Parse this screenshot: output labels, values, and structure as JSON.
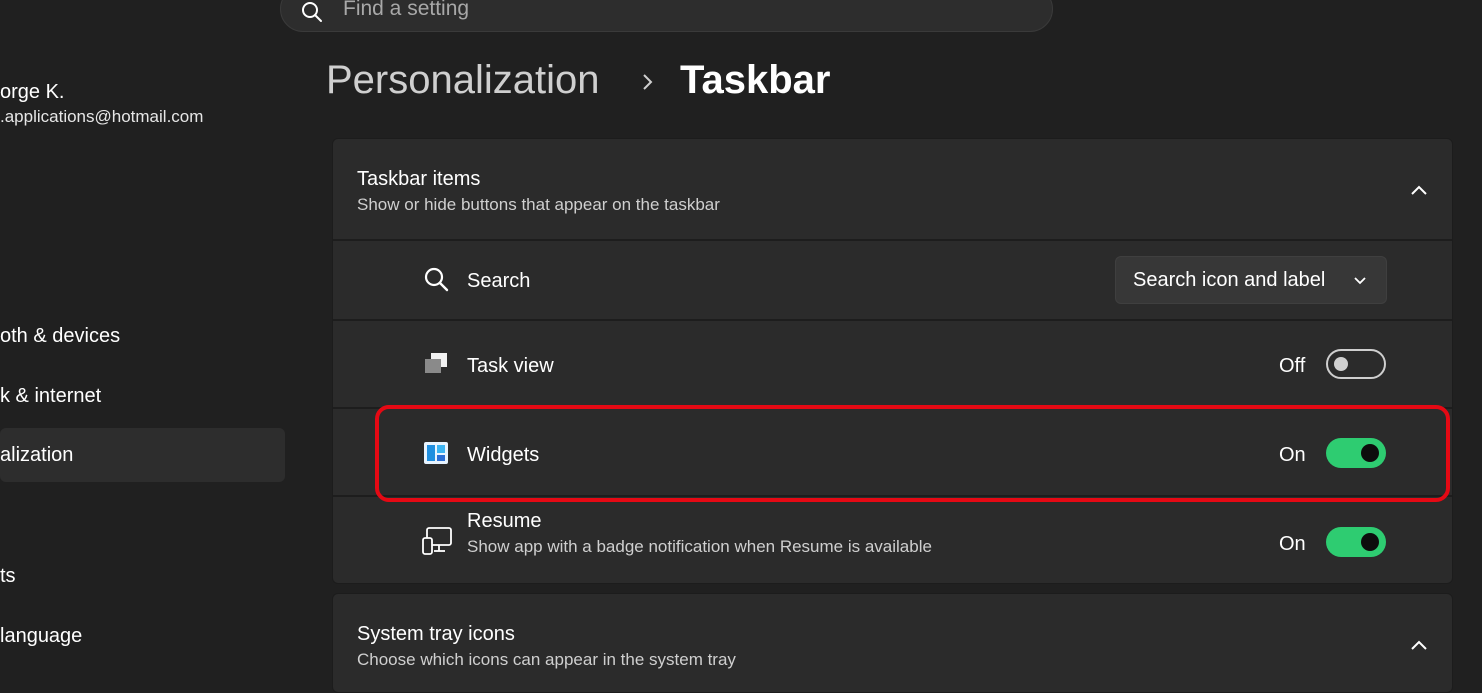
{
  "search": {
    "placeholder": "Find a setting"
  },
  "user": {
    "name": "orge K.",
    "email": ".applications@hotmail.com"
  },
  "sidebar": {
    "items": [
      {
        "label": "oth & devices"
      },
      {
        "label": "k & internet"
      },
      {
        "label": "alization",
        "selected": true
      },
      {
        "label": "ts"
      },
      {
        "label": " language"
      }
    ]
  },
  "breadcrumb": {
    "parent": "Personalization",
    "separator": "›",
    "current": "Taskbar"
  },
  "taskbar_items": {
    "title": "Taskbar items",
    "subtitle": "Show or hide buttons that appear on the taskbar",
    "rows": [
      {
        "label": "Search",
        "icon": "search-icon",
        "control": "dropdown",
        "value": "Search icon and label"
      },
      {
        "label": "Task view",
        "icon": "task-view-icon",
        "control": "toggle",
        "state": "Off"
      },
      {
        "label": "Widgets",
        "icon": "widgets-icon",
        "control": "toggle",
        "state": "On",
        "highlighted": true
      },
      {
        "label": "Resume",
        "subtitle": "Show app with a badge notification when Resume is available",
        "icon": "resume-icon",
        "control": "toggle",
        "state": "On"
      }
    ]
  },
  "system_tray": {
    "title": "System tray icons",
    "subtitle": "Choose which icons can appear in the system tray"
  },
  "colors": {
    "background": "#202020",
    "card": "#2b2b2b",
    "toggle_on": "#2ecc71",
    "highlight": "#e50914"
  }
}
